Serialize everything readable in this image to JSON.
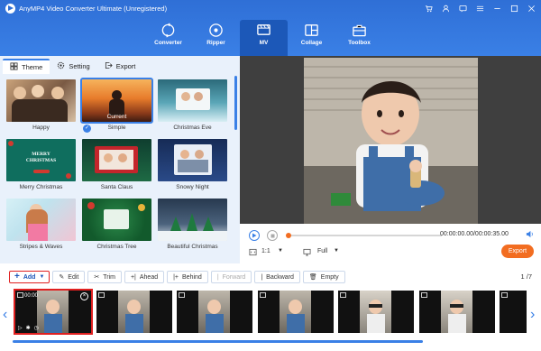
{
  "app": {
    "title": "AnyMP4 Video Converter Ultimate (Unregistered)"
  },
  "window_controls": [
    "cart-icon",
    "user-icon",
    "chat-icon",
    "menu-icon",
    "minimize-icon",
    "maximize-icon",
    "close-icon"
  ],
  "nav": {
    "items": [
      {
        "label": "Converter",
        "icon": "converter-icon"
      },
      {
        "label": "Ripper",
        "icon": "ripper-icon"
      },
      {
        "label": "MV",
        "icon": "mv-icon",
        "active": true
      },
      {
        "label": "Collage",
        "icon": "collage-icon"
      },
      {
        "label": "Toolbox",
        "icon": "toolbox-icon"
      }
    ]
  },
  "tabs": [
    {
      "label": "Theme",
      "icon": "theme-icon",
      "active": true
    },
    {
      "label": "Setting",
      "icon": "setting-icon"
    },
    {
      "label": "Export",
      "icon": "export-icon"
    }
  ],
  "themes": [
    {
      "name": "Happy"
    },
    {
      "name": "Simple",
      "current_label": "Current",
      "selected": true
    },
    {
      "name": "Christmas Eve"
    },
    {
      "name": "Merry Christmas",
      "overlay_text": "MERRY CHRISTMAS"
    },
    {
      "name": "Santa Claus"
    },
    {
      "name": "Snowy Night"
    },
    {
      "name": "Stripes & Waves"
    },
    {
      "name": "Christmas Tree"
    },
    {
      "name": "Beautiful Christmas"
    }
  ],
  "player": {
    "aspect_ratio": "1:1",
    "zoom": "Full",
    "timecode": "00:00:00.00/00:00:35.00",
    "progress": 0,
    "export_label": "Export"
  },
  "toolbar": {
    "add": "Add",
    "edit": "Edit",
    "trim": "Trim",
    "ahead": "Ahead",
    "behind": "Behind",
    "forward": "Forward",
    "backward": "Backward",
    "empty": "Empty",
    "page": "1 /7"
  },
  "timeline": {
    "clips": [
      {
        "duration": "00:00",
        "selected": true
      },
      {},
      {},
      {},
      {},
      {},
      {}
    ]
  },
  "colors": {
    "accent": "#3a80e6",
    "header": "#2f6fd6",
    "export": "#f26d21",
    "highlight_red": "#e02020"
  }
}
